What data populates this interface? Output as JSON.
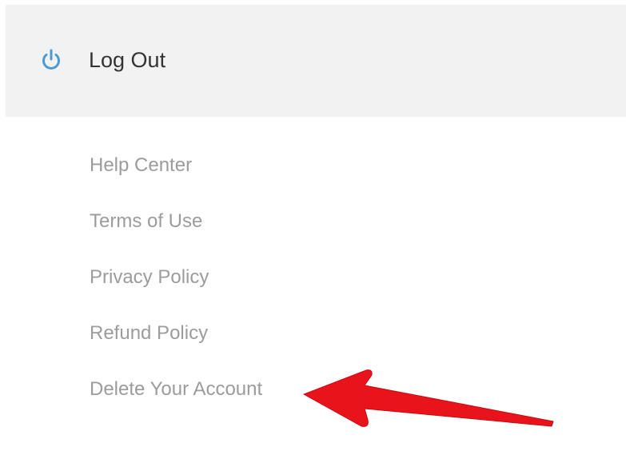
{
  "menu": {
    "logout": {
      "label": "Log Out",
      "icon": "power-icon",
      "icon_color": "#4a9ad6"
    },
    "links": [
      {
        "label": "Help Center"
      },
      {
        "label": "Terms of Use"
      },
      {
        "label": "Privacy Policy"
      },
      {
        "label": "Refund Policy"
      },
      {
        "label": "Delete Your Account"
      }
    ]
  },
  "annotation": {
    "icon": "red-arrow-icon",
    "color": "#e8131b"
  }
}
